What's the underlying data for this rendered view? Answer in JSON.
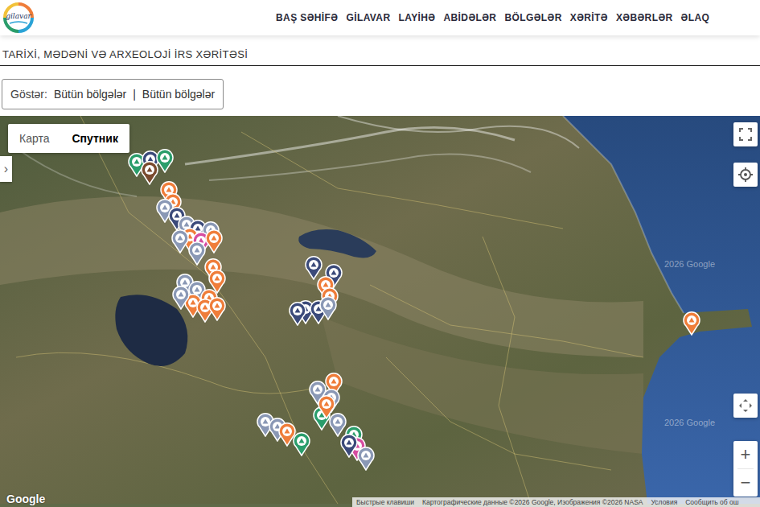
{
  "header": {
    "logo": "gilavar",
    "nav": [
      "BAŞ SƏHİFƏ",
      "GİLAVAR",
      "LAYİHƏ",
      "ABİDƏLƏR",
      "BÖLGƏLƏR",
      "XƏRİTƏ",
      "XƏBƏRLƏR",
      "ƏLAQ"
    ]
  },
  "page_title": "TARİXİ, MƏDƏNİ VƏ ARXEOLOJİ İRS XƏRİTƏSİ",
  "filter": {
    "label": "Göstər:",
    "values": [
      "Bütün bölgələr",
      "Bütün bölgələr"
    ],
    "separator": "|"
  },
  "map": {
    "type_tabs": [
      {
        "label": "Карта",
        "selected": false
      },
      {
        "label": "Спутник",
        "selected": true
      }
    ],
    "side_toggle": "›",
    "watermarks": [
      "2026 Google",
      "2026 Google"
    ],
    "logo": "Google",
    "attribution": [
      "Быстрые клавиши",
      "Картографические данные ©2026 Google, Изображения ©2026 NASA",
      "Условия",
      "Сообщить об ош"
    ],
    "zoom_in": "+",
    "zoom_out": "−",
    "pins": [
      {
        "color": "#2a9d6b"
      },
      {
        "color": "#3b4a7a"
      },
      {
        "color": "#2a9d6b"
      },
      {
        "color": "#7a4a2e"
      },
      {
        "color": "#ef7d3a"
      },
      {
        "color": "#ef7d3a"
      },
      {
        "color": "#8a98b5"
      },
      {
        "color": "#3b4a7a"
      },
      {
        "color": "#8a98b5"
      },
      {
        "color": "#3b4a7a"
      },
      {
        "color": "#8a98b5"
      },
      {
        "color": "#ef7d3a"
      },
      {
        "color": "#d64ca0"
      },
      {
        "color": "#8a98b5"
      },
      {
        "color": "#8a98b5"
      },
      {
        "color": "#ef7d3a"
      },
      {
        "color": "#ef7d3a"
      },
      {
        "color": "#ef7d3a"
      },
      {
        "color": "#8a98b5"
      },
      {
        "color": "#8a98b5"
      },
      {
        "color": "#ef7d3a"
      },
      {
        "color": "#ef7d3a"
      },
      {
        "color": "#ef7d3a"
      },
      {
        "color": "#ef7d3a"
      },
      {
        "color": "#8a98b5"
      },
      {
        "color": "#3b4a7a"
      },
      {
        "color": "#3b4a7a"
      },
      {
        "color": "#ef7d3a"
      },
      {
        "color": "#ef7d3a"
      },
      {
        "color": "#3b4a7a"
      },
      {
        "color": "#3b4a7a"
      },
      {
        "color": "#8a98b5"
      },
      {
        "color": "#3b4a7a"
      },
      {
        "color": "#ef7d3a"
      },
      {
        "color": "#8a98b5"
      },
      {
        "color": "#ef7d3a"
      },
      {
        "color": "#8a98b5"
      },
      {
        "color": "#2a9d6b"
      },
      {
        "color": "#8a98b5"
      },
      {
        "color": "#ef7d3a"
      },
      {
        "color": "#8a98b5"
      },
      {
        "color": "#8a98b5"
      },
      {
        "color": "#ef7d3a"
      },
      {
        "color": "#2a9d6b"
      },
      {
        "color": "#2a9d6b"
      },
      {
        "color": "#d64ca0"
      },
      {
        "color": "#8a98b5"
      },
      {
        "color": "#3b4a7a"
      }
    ]
  }
}
